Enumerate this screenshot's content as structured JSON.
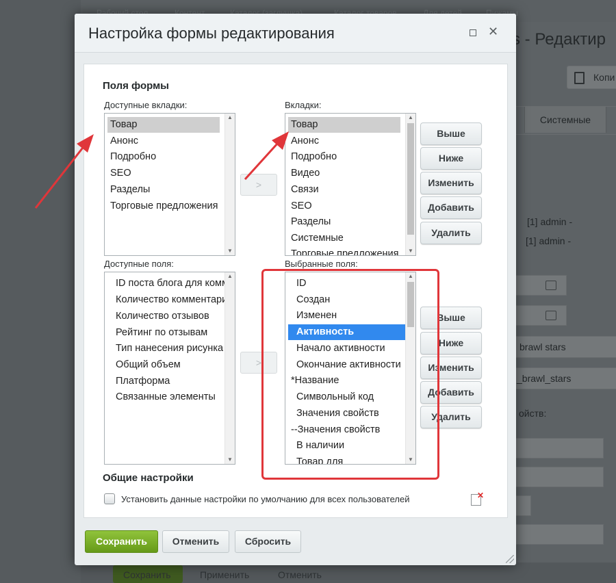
{
  "background": {
    "breadcrumbs": [
      "Рабочий стол",
      "Контент",
      "Каталог (заглушка)",
      "Каталог товаров",
      "Для детей",
      "Пижамы"
    ],
    "page_title": "s - Редактир",
    "copy_button": "Копи",
    "tab": "Системные",
    "admin_texts": [
      "[1] admin -",
      "[1] admin -"
    ],
    "input_texts": [
      "brawl stars",
      "_brawl_stars"
    ],
    "props_label": "ойств:",
    "bottom_buttons": [
      "Сохранить",
      "Применить",
      "Отменить"
    ]
  },
  "dialog": {
    "title": "Настройка формы редактирования",
    "section_fields": "Поля формы",
    "available_tabs_label": "Доступные вкладки:",
    "tabs_label": "Вкладки:",
    "available_fields_label": "Доступные поля:",
    "selected_fields_label": "Выбранные поля:",
    "available_tabs": [
      "Товар",
      "Анонс",
      "Подробно",
      "SEO",
      "Разделы",
      "Торговые предложения"
    ],
    "tabs": [
      "Товар",
      "Анонс",
      "Подробно",
      "Видео",
      "Связи",
      "SEO",
      "Разделы",
      "Системные",
      "Торговые предложения"
    ],
    "available_fields": [
      "ID поста блога для комментариев",
      "Количество комментариев",
      "Количество отзывов",
      "Рейтинг по отзывам",
      "Тип нанесения рисунка",
      "Общий объем",
      "Платформа",
      "Связанные элементы"
    ],
    "selected_fields": [
      "ID",
      "Создан",
      "Изменен",
      "Активность",
      "Начало активности",
      "Окончание активности",
      "*Название",
      "Символьный код",
      "Значения свойств",
      "--Значения свойств",
      "В наличии",
      "Товар для"
    ],
    "move_button": ">",
    "side_buttons": [
      "Выше",
      "Ниже",
      "Изменить",
      "Добавить",
      "Удалить"
    ],
    "section_general": "Общие настройки",
    "default_checkbox_label": "Установить данные настройки по умолчанию для всех пользователей",
    "save": "Сохранить",
    "cancel": "Отменить",
    "reset": "Сбросить"
  }
}
